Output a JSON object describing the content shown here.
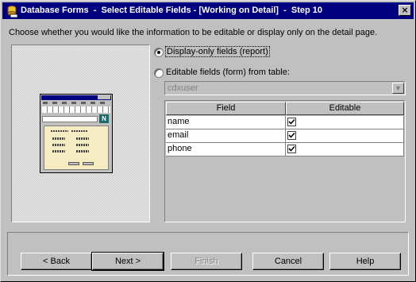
{
  "window": {
    "title": "Database Forms  -  Select Editable Fields - [Working on Detail]  -  Step 10",
    "close_glyph": "×"
  },
  "instruction": "Choose whether you would like the information to be editable or display only on the detail page.",
  "options": {
    "display_only": {
      "label": "Display-only fields (report)",
      "selected": true
    },
    "editable": {
      "label": "Editable fields (form) from table:",
      "selected": false
    }
  },
  "table_select": {
    "value": "cdxuser",
    "enabled": false
  },
  "grid": {
    "headers": [
      "Field",
      "Editable"
    ],
    "rows": [
      {
        "field": "name",
        "editable": true
      },
      {
        "field": "email",
        "editable": true
      },
      {
        "field": "phone",
        "editable": true
      }
    ]
  },
  "preview": {
    "logo_letter": "N"
  },
  "buttons": {
    "back": "< Back",
    "next": "Next >",
    "finish": "Finish",
    "cancel": "Cancel",
    "help": "Help"
  }
}
